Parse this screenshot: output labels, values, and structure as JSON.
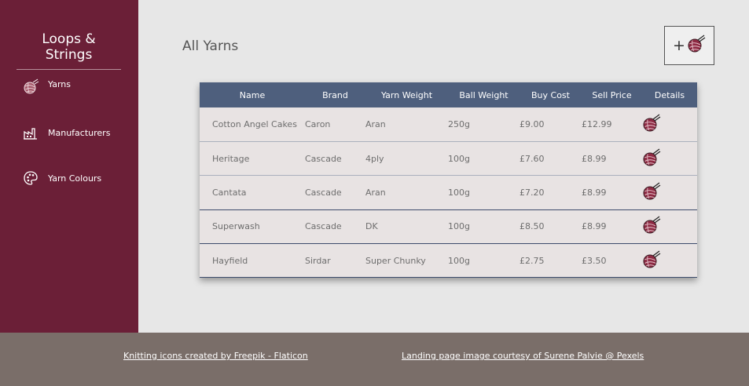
{
  "brand": "Loops & Strings",
  "nav": [
    {
      "label": "Yarns",
      "icon": "yarn-ball-icon"
    },
    {
      "label": "Manufacturers",
      "icon": "factory-icon"
    },
    {
      "label": "Yarn Colours",
      "icon": "palette-icon"
    }
  ],
  "page_title": "All Yarns",
  "add_button": {
    "plus": "+",
    "icon": "yarn-ball-icon"
  },
  "table": {
    "headers": [
      "Name",
      "Brand",
      "Yarn Weight",
      "Ball Weight",
      "Buy Cost",
      "Sell Price",
      "Details"
    ],
    "rows": [
      [
        "Cotton Angel Cakes",
        "Caron",
        "Aran",
        "250g",
        "£9.00",
        "£12.99"
      ],
      [
        "Heritage",
        "Cascade",
        "4ply",
        "100g",
        "£7.60",
        "£8.99"
      ],
      [
        "Cantata",
        "Cascade",
        "Aran",
        "100g",
        "£7.20",
        "£8.99"
      ],
      [
        "Superwash",
        "Cascade",
        "DK",
        "100g",
        "£8.50",
        "£8.99"
      ],
      [
        "Hayfield",
        "Sirdar",
        "Super Chunky",
        "100g",
        "£2.75",
        "£3.50"
      ]
    ]
  },
  "footer": {
    "credit_icons": "Knitting icons created by Freepik - Flaticon",
    "credit_image": "Landing page image courtesy of Surene Palvie @ Pexels"
  },
  "colors": {
    "sidebar": "#6b1f37",
    "table_header": "#4e5f7d",
    "footer": "#7a6e69",
    "yarn_ball": "#8e2a43"
  }
}
